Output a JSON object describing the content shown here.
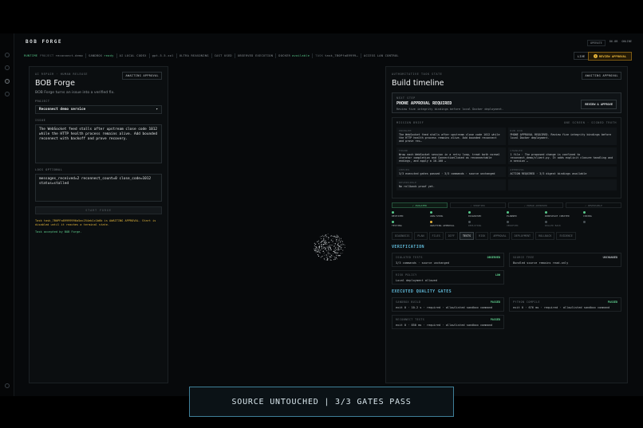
{
  "app": {
    "title": "BOB FORGE"
  },
  "topright": {
    "a": "OPERATE",
    "b": "86.8B",
    "c": "ONLINE"
  },
  "statusbar": {
    "runtime": "RUNTIME",
    "project_k": "PROJECT",
    "project_v": "reconnect-demo",
    "sandbox_k": "SANDBOX",
    "sandbox_v": "ready",
    "ai_k": "AI",
    "ai_v": "LOCAL CODEX",
    "model_k": "gpt-5.5-xol",
    "reasoning": "ULTRA REASONING",
    "cast_k": "CAST USED",
    "exec": "OBSERVED EXECUTION",
    "docker_k": "DOCKER",
    "docker_v": "available",
    "task_k": "TASK",
    "task_v": "task_7B0Pfa89999…",
    "access_k": "ACCESS",
    "access_v": "LAN CONTROL",
    "live": "LIVE",
    "review": "REVIEW APPROVAL"
  },
  "left": {
    "kicker": "AI REPAIR · HUMAN RELEASE",
    "badge": "AWAITING APPROVAL",
    "title": "BOB Forge",
    "subtitle": "BOB Forge turns an issue into a verified fix.",
    "project_label": "PROJECT",
    "project_value": "Reconnect demo service",
    "issue_label": "ISSUE",
    "issue_value": "The WebSocket feed stalls after upstream close code 1012 while the HTTP health process remains alive. Add bounded reconnect with backoff and prove recovery.",
    "logs_label": "LOGS OPTIONAL",
    "logs_value": "messages_received=2 reconnect_count=0 close_code=1012 status=stalled",
    "start_button": "START FORGE",
    "log_warn": "Task task_7B0PFa89999996a5ac254eb1c1b6b is AWAITING APPROVAL. Start is disabled until it reaches a terminal state.",
    "log_ok": "Task accepted by BOB Forge."
  },
  "right": {
    "kicker": "AUTHORITATIVE TASK STATE",
    "badge": "AWAITING APPROVAL",
    "title": "Build timeline",
    "next_step_label": "NEXT STEP",
    "next_step_title": "PHONE APPROVAL REQUIRED",
    "next_step_desc": "Review five integrity bindings before local Docker deployment.",
    "review_button": "REVIEW & APPROVE",
    "mission_label": "MISSION BRIEF",
    "mission_meta": "ONE SCREEN · SIGNED TRUTH",
    "mission_cells": [
      {
        "t": "PROBLEM",
        "v": "The WebSocket feed stalls after upstream close code 1012 while the HTTP health process remains alive. Add bounded reconnect and prove rec…"
      },
      {
        "t": "RUN NOW",
        "v": "PHONE APPROVAL REQUIRED. Review five integrity bindings before local Docker deployment."
      },
      {
        "t": "FOUND",
        "v": "Wrap each WebSocket session in a retry loop, treat both normal iterator completion and ConnectionClosed as reconnectable endings, and apply a 10-100 …"
      },
      {
        "t": "CHANGED",
        "v": "1 file · The proposed change is confined to reconnect_demo/client.py. It adds explicit closure handling and a session …"
      },
      {
        "t": "CHECKS",
        "v": "3/3 executed gates passed · 3/3 commands · source unchanged"
      },
      {
        "t": "APPROVAL",
        "v": "ACTION REQUIRED · 3/3 digest bindings available"
      },
      {
        "t": "REVERSIBLE",
        "v": "No rollback proof yet."
      },
      {
        "t": "",
        "v": ""
      }
    ],
    "phase_tabs": [
      "✓ ISOLATED",
      "✓ VERIFIED",
      "✓ HUMAN APPROVED",
      "✓ REVERSIBLE"
    ],
    "stages": [
      {
        "n": "RECEIVED",
        "s": "done"
      },
      {
        "n": "ANALYZING",
        "s": "done"
      },
      {
        "n": "DIAGNOSED",
        "s": "done"
      },
      {
        "n": "PLANNED",
        "s": "done"
      },
      {
        "n": "WORKSPACE CREATED",
        "s": "done"
      },
      {
        "n": "CODING",
        "s": "done"
      },
      {
        "n": "TESTING",
        "s": "done"
      },
      {
        "n": "AWAITING APPROVAL",
        "s": "cur"
      },
      {
        "n": "DEPLOYING",
        "s": ""
      },
      {
        "n": "VERIFIED",
        "s": ""
      },
      {
        "n": "ROLLED BACK",
        "s": ""
      },
      {
        "n": "",
        "s": ""
      }
    ],
    "tabs": [
      "DIAGNOSIS",
      "PLAN",
      "FILES",
      "DIFF",
      "TESTS",
      "RISK",
      "APPROVAL",
      "DEPLOYMENT",
      "ROLLBACK",
      "EVIDENCE"
    ],
    "verification_title": "VERIFICATION",
    "verification": [
      {
        "t": "ISOLATED TESTS",
        "v": "3/3 commands · source unchanged",
        "s": "OBSERVED",
        "c": "g"
      },
      {
        "t": "SOURCE TREE",
        "v": "Bundled source remains read-only",
        "s": "UNCHANGED",
        "c": "gray"
      },
      {
        "t": "RISK POLICY",
        "v": "Local deployment allowed",
        "s": "LOW",
        "c": "g"
      }
    ],
    "gates_title": "EXECUTED QUALITY GATES",
    "gates": [
      {
        "t": "SANDBOX BUILD",
        "v": "exit 0 · 10.2 s · required · allowlisted sandbox command",
        "s": "PASSED",
        "c": "g"
      },
      {
        "t": "PYTHON COMPILE",
        "v": "exit 0 · 676 ms · required · allowlisted sandbox command",
        "s": "PASSED",
        "c": "g"
      },
      {
        "t": "RECONNECT TESTS",
        "v": "exit 0 · 850 ms · required · allowlisted sandbox command",
        "s": "PASSED",
        "c": "g"
      }
    ]
  },
  "banner": "SOURCE UNTOUCHED  |  3/3 GATES PASS"
}
